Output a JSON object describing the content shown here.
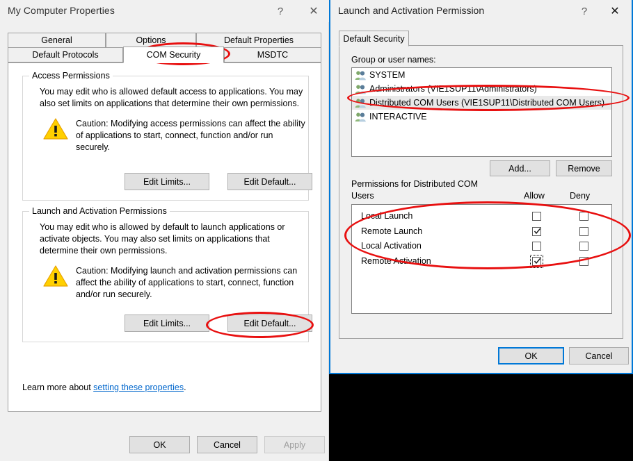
{
  "left_dialog": {
    "title": "My Computer Properties",
    "titlebar_buttons": [
      {
        "name": "help",
        "glyph": "?"
      },
      {
        "name": "close",
        "glyph": "✕"
      }
    ],
    "tabs_row1": [
      "General",
      "Options",
      "Default Properties"
    ],
    "tabs_row2": [
      "Default Protocols",
      "COM Security",
      "MSDTC"
    ],
    "selected_tab": "COM Security",
    "access_permissions": {
      "legend": "Access Permissions",
      "description_line1": "You may edit who is allowed default access to applications. You may",
      "description_line2": "also set limits on applications that determine their own permissions.",
      "caution_line1": "Caution: Modifying access permissions can affect the ability",
      "caution_line2": "of applications to start, connect, function and/or run",
      "caution_line3": "securely.",
      "edit_limits_label": "Edit Limits...",
      "edit_default_label": "Edit Default..."
    },
    "launch_permissions": {
      "legend": "Launch and Activation Permissions",
      "description_line1": "You may edit who is allowed by default to launch applications or",
      "description_line2": "activate objects. You may also set limits on applications that",
      "description_line3": "determine their own permissions.",
      "caution_line1": "Caution: Modifying launch and activation permissions can",
      "caution_line2": "affect the ability of applications to start, connect, function",
      "caution_line3": "and/or run securely.",
      "edit_limits_label": "Edit Limits...",
      "edit_default_label": "Edit Default..."
    },
    "learn_more_prefix": "Learn more about ",
    "learn_more_link": "setting these properties",
    "learn_more_suffix": ".",
    "footer_buttons": {
      "ok": "OK",
      "cancel": "Cancel",
      "apply": "Apply",
      "apply_disabled": true
    }
  },
  "right_dialog": {
    "title": "Launch and Activation Permission",
    "titlebar_buttons": [
      {
        "name": "help",
        "glyph": "?"
      },
      {
        "name": "close",
        "glyph": "✕"
      }
    ],
    "tab_label": "Default Security",
    "group_list_label": "Group or user names:",
    "users": [
      {
        "name": "SYSTEM",
        "selected": false
      },
      {
        "name": "Administrators (VIE1SUP11\\Administrators)",
        "selected": false
      },
      {
        "name": "Distributed COM Users (VIE1SUP11\\Distributed COM Users)",
        "selected": true
      },
      {
        "name": "INTERACTIVE",
        "selected": false
      }
    ],
    "add_button": "Add...",
    "remove_button": "Remove",
    "permissions_label_line1": "Permissions for Distributed COM",
    "permissions_label_line2": "Users",
    "columns": [
      "Allow",
      "Deny"
    ],
    "permissions": [
      {
        "name": "Local Launch",
        "allow": false,
        "deny": false,
        "focused": false
      },
      {
        "name": "Remote Launch",
        "allow": true,
        "deny": false,
        "focused": false
      },
      {
        "name": "Local Activation",
        "allow": false,
        "deny": false,
        "focused": false
      },
      {
        "name": "Remote Activation",
        "allow": true,
        "deny": false,
        "focused": true
      }
    ],
    "footer_buttons": {
      "ok": "OK",
      "cancel": "Cancel",
      "ok_focused": true
    }
  },
  "annotations": {
    "color": "#e81010",
    "ellipses": [
      {
        "target": "com-security-tab"
      },
      {
        "target": "launch-edit-default-button"
      },
      {
        "target": "distributed-com-users-row"
      },
      {
        "target": "permissions-checkbox-group"
      }
    ]
  },
  "colors": {
    "accent": "#0078d7",
    "link": "#0066cc",
    "annotation_red": "#e81010",
    "warning_yellow": "#ffd000",
    "dialog_bg": "#f0f0f0",
    "panel_bg": "#ffffff"
  }
}
